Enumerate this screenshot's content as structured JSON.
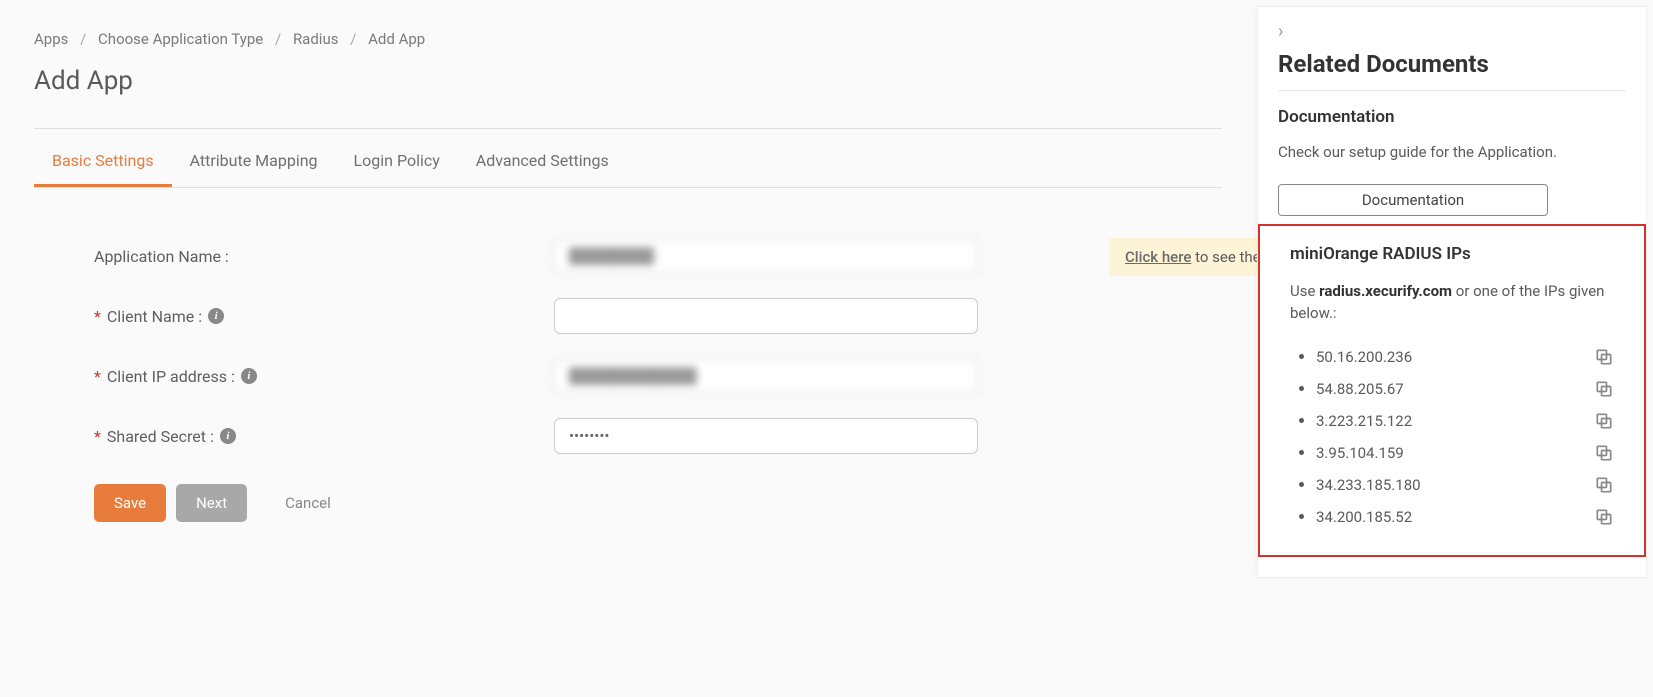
{
  "breadcrumb": {
    "items": [
      "Apps",
      "Choose Application Type",
      "Radius",
      "Add App"
    ]
  },
  "page_title": "Add App",
  "tabs": [
    {
      "label": "Basic Settings",
      "active": true
    },
    {
      "label": "Attribute Mapping",
      "active": false
    },
    {
      "label": "Login Policy",
      "active": false
    },
    {
      "label": "Advanced Settings",
      "active": false
    }
  ],
  "form": {
    "app_name_label": "Application Name :",
    "app_name_value": "████████",
    "client_name_label": "Client Name :",
    "client_name_value": "",
    "client_ip_label": "Client IP address :",
    "client_ip_value": "████████████",
    "shared_secret_label": "Shared Secret :",
    "shared_secret_value": "••••••••"
  },
  "hint": {
    "link_text": "Click here",
    "rest_text": " to see the miniOrange R"
  },
  "buttons": {
    "save": "Save",
    "next": "Next",
    "cancel": "Cancel"
  },
  "panel": {
    "title": "Related Documents",
    "doc_heading": "Documentation",
    "doc_text": "Check our setup guide for the Application.",
    "doc_button": "Documentation",
    "ips_heading": "miniOrange RADIUS IPs",
    "ips_use": "Use ",
    "ips_domain": "radius.xecurify.com",
    "ips_rest": " or one of the IPs given below.:",
    "ips": [
      "50.16.200.236",
      "54.88.205.67",
      "3.223.215.122",
      "3.95.104.159",
      "34.233.185.180",
      "34.200.185.52"
    ]
  }
}
